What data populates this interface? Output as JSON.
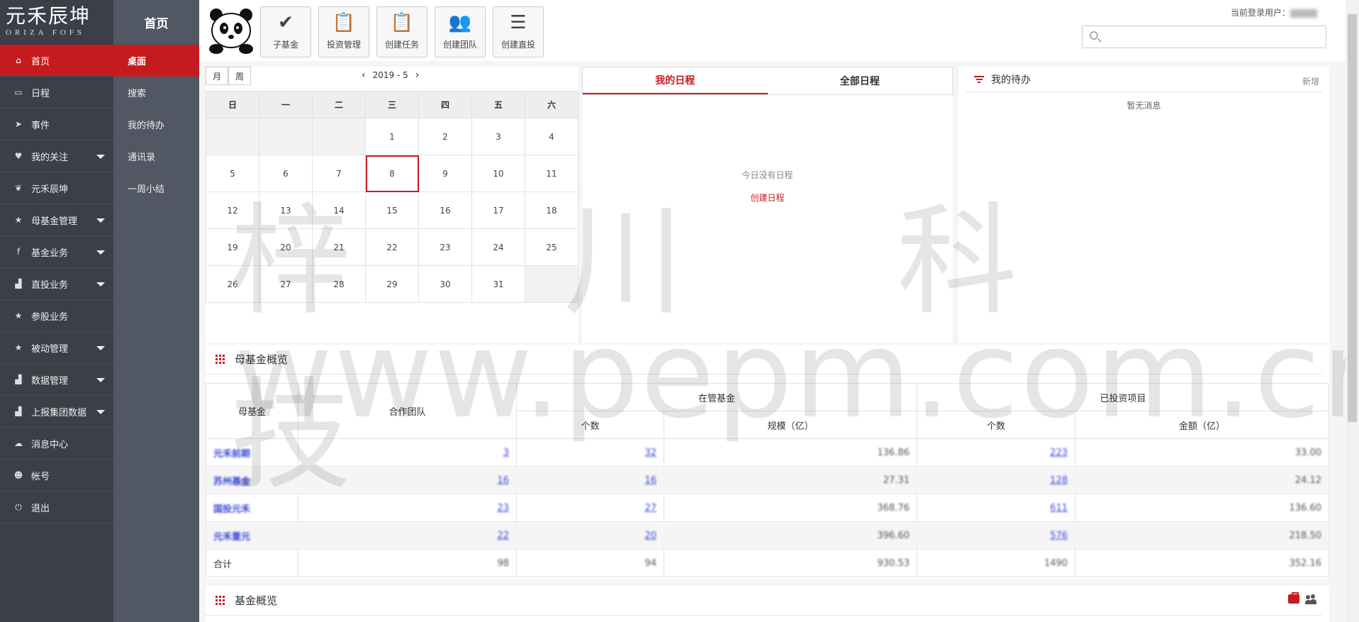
{
  "logo": {
    "cn": "元禾辰坤",
    "en": "ORIZA FOFS"
  },
  "nav1": [
    {
      "label": "首页",
      "icon": "home-icon",
      "glyph": "⌂",
      "active": true,
      "caret": false
    },
    {
      "label": "日程",
      "icon": "calendar-icon",
      "glyph": "▭",
      "caret": false
    },
    {
      "label": "事件",
      "icon": "send-icon",
      "glyph": "➤",
      "caret": false
    },
    {
      "label": "我的关注",
      "icon": "heart-icon",
      "glyph": "♥",
      "caret": true
    },
    {
      "label": "元禾辰坤",
      "icon": "leaf-icon",
      "glyph": "❦",
      "caret": false
    },
    {
      "label": "母基金管理",
      "icon": "star-icon",
      "glyph": "★",
      "caret": true
    },
    {
      "label": "基金业务",
      "icon": "facebook-f-icon",
      "glyph": "f",
      "caret": true
    },
    {
      "label": "直投业务",
      "icon": "bar-chart-icon",
      "glyph": "▟",
      "caret": true
    },
    {
      "label": "参股业务",
      "icon": "star-icon",
      "glyph": "★",
      "caret": false
    },
    {
      "label": "被动管理",
      "icon": "star-icon",
      "glyph": "★",
      "caret": true
    },
    {
      "label": "数据管理",
      "icon": "bar-chart-icon",
      "glyph": "▟",
      "caret": true
    },
    {
      "label": "上报集团数据",
      "icon": "bar-chart-icon",
      "glyph": "▟",
      "caret": true
    },
    {
      "label": "消息中心",
      "icon": "chat-icon",
      "glyph": "☁",
      "caret": false
    },
    {
      "label": "帐号",
      "icon": "user-icon",
      "glyph": "☻",
      "caret": false
    },
    {
      "label": "退出",
      "icon": "power-icon",
      "glyph": "⏻",
      "caret": false
    }
  ],
  "nav2": {
    "title": "首页",
    "items": [
      "桌面",
      "搜索",
      "我的待办",
      "通讯录",
      "一周小结"
    ]
  },
  "toolbar": [
    {
      "label": "子基金",
      "icon": "check-icon",
      "glyph": "✔"
    },
    {
      "label": "投资管理",
      "icon": "clipboard-icon",
      "glyph": "📋"
    },
    {
      "label": "创建任务",
      "icon": "clipboard-icon",
      "glyph": "📋"
    },
    {
      "label": "创建团队",
      "icon": "users-icon",
      "glyph": "👥"
    },
    {
      "label": "创建直投",
      "icon": "menu-icon",
      "glyph": "☰"
    }
  ],
  "user": {
    "label": "当前登录用户："
  },
  "search": {
    "placeholder": ""
  },
  "calendar": {
    "modes": [
      "月",
      "周"
    ],
    "period": "2019 - 5",
    "weekdays": [
      "日",
      "一",
      "二",
      "三",
      "四",
      "五",
      "六"
    ],
    "weeks": [
      [
        "",
        "",
        "",
        "1",
        "2",
        "3",
        "4"
      ],
      [
        "5",
        "6",
        "7",
        "8",
        "9",
        "10",
        "11"
      ],
      [
        "12",
        "13",
        "14",
        "15",
        "16",
        "17",
        "18"
      ],
      [
        "19",
        "20",
        "21",
        "22",
        "23",
        "24",
        "25"
      ],
      [
        "26",
        "27",
        "28",
        "29",
        "30",
        "31",
        ""
      ]
    ],
    "today": "8"
  },
  "schedule": {
    "tabs": [
      "我的日程",
      "全部日程"
    ],
    "empty_text": "今日没有日程",
    "create_link": "创建日程"
  },
  "todo": {
    "title": "我的待办",
    "add_label": "新增",
    "empty_text": "暂无消息"
  },
  "mother_fund": {
    "title": "母基金概览",
    "headers": {
      "fund": "母基金",
      "team": "合作团队",
      "managed": "在管基金",
      "invested": "已投资项目",
      "count": "个数",
      "scale": "规模（亿）",
      "amount": "金额（亿）"
    },
    "rows": [
      {
        "name": "元禾前期",
        "team": "3",
        "count": "32",
        "scale": "136.86",
        "proj": "223",
        "amount": "33.00"
      },
      {
        "name": "苏州基金",
        "team": "16",
        "count": "16",
        "scale": "27.31",
        "proj": "128",
        "amount": "24.12"
      },
      {
        "name": "国投元禾",
        "team": "23",
        "count": "27",
        "scale": "368.76",
        "proj": "611",
        "amount": "136.60"
      },
      {
        "name": "元禾重元",
        "team": "22",
        "count": "20",
        "scale": "396.60",
        "proj": "576",
        "amount": "218.50"
      }
    ],
    "total": {
      "name": "合计",
      "team": "98",
      "count": "94",
      "scale": "930.53",
      "proj": "1490",
      "amount": "352.16"
    }
  },
  "fund_overview": {
    "title": "基金概览"
  },
  "watermark": {
    "line1": "梓川科技",
    "line2": "www.pepm.com.cn"
  },
  "colors": {
    "accent": "#c51b1e",
    "nav_dark": "#3d3f48",
    "nav_mid": "#525764",
    "link": "#3b4ad6"
  }
}
